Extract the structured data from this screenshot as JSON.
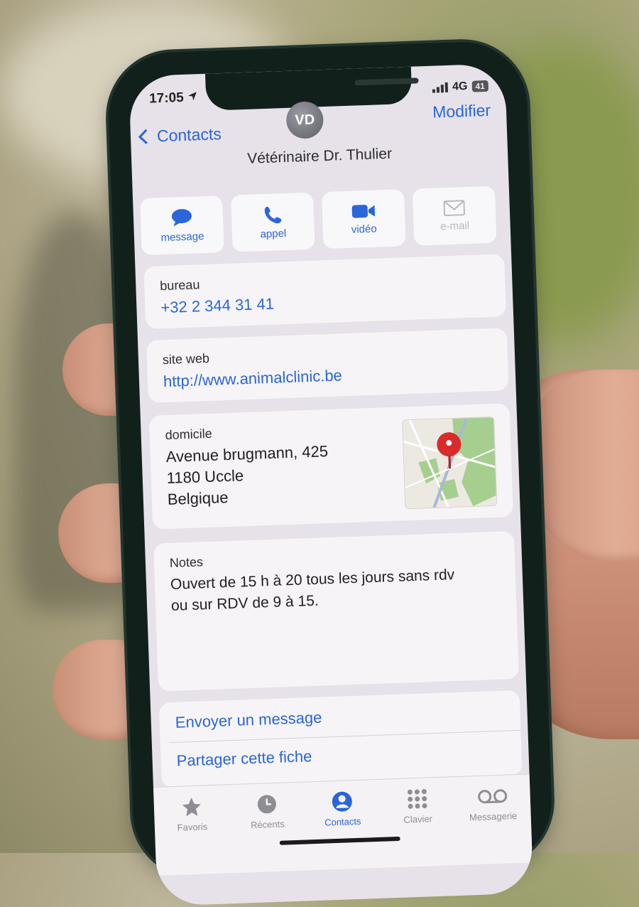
{
  "status_bar": {
    "time": "17:05",
    "network": "4G",
    "battery": "41"
  },
  "nav": {
    "back_label": "Contacts",
    "edit_label": "Modifier"
  },
  "contact": {
    "initials": "VD",
    "name": "Vétérinaire Dr. Thulier"
  },
  "actions": [
    {
      "label": "message",
      "icon": "message-bubble-icon",
      "enabled": true
    },
    {
      "label": "appel",
      "icon": "phone-icon",
      "enabled": true
    },
    {
      "label": "vidéo",
      "icon": "video-camera-icon",
      "enabled": true
    },
    {
      "label": "e-mail",
      "icon": "envelope-icon",
      "enabled": false
    }
  ],
  "phone": {
    "label": "bureau",
    "value": "+32 2 344 31 41"
  },
  "website": {
    "label": "site web",
    "value": "http://www.animalclinic.be"
  },
  "address": {
    "label": "domicile",
    "line1": "Avenue brugmann, 425",
    "line2": "1180 Uccle",
    "line3": "Belgique"
  },
  "notes": {
    "label": "Notes",
    "line1": "Ouvert de 15 h à 20 tous les jours sans rdv",
    "line2": "ou sur RDV de 9 à 15."
  },
  "links": {
    "send_message": "Envoyer un message",
    "share_card": "Partager cette fiche"
  },
  "tabs": [
    {
      "label": "Favoris",
      "icon": "star-icon",
      "active": false
    },
    {
      "label": "Récents",
      "icon": "clock-icon",
      "active": false
    },
    {
      "label": "Contacts",
      "icon": "person-circle-icon",
      "active": true
    },
    {
      "label": "Clavier",
      "icon": "keypad-icon",
      "active": false
    },
    {
      "label": "Messagerie",
      "icon": "voicemail-icon",
      "active": false
    }
  ],
  "colors": {
    "accent": "#2a66d9",
    "map_pin": "#d92b2b"
  }
}
